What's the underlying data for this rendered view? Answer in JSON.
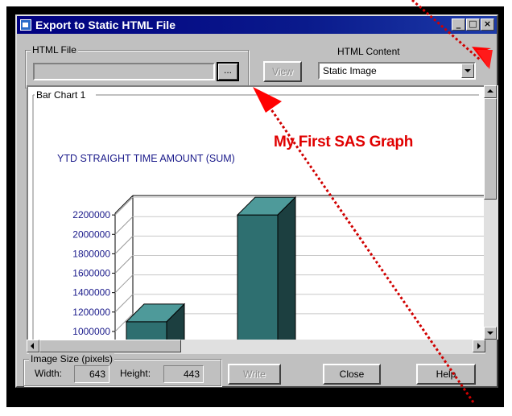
{
  "window": {
    "title": "Export to Static HTML File",
    "caption_buttons": [
      "_",
      "□",
      "×"
    ]
  },
  "html_file": {
    "group_label": "HTML File",
    "path_value": "",
    "browse_label": "...",
    "view_label": "View"
  },
  "html_content": {
    "label": "HTML Content",
    "selected": "Static Image"
  },
  "chart_pane": {
    "group_label": "Bar Chart 1"
  },
  "annotation": {
    "text": "My First SAS Graph",
    "color": "#e00000"
  },
  "image_size": {
    "group_label": "Image Size (pixels)",
    "width_label": "Width:",
    "width_value": "643",
    "height_label": "Height:",
    "height_value": "443"
  },
  "buttons": {
    "write": "Write",
    "close": "Close",
    "help": "Help"
  },
  "chart_data": {
    "type": "bar",
    "title": "YTD STRAIGHT TIME AMOUNT (SUM)",
    "ytick_labels": [
      "2200000",
      "2000000",
      "1800000",
      "1600000",
      "1400000",
      "1200000",
      "1000000"
    ],
    "ylim": [
      900000,
      2400000
    ],
    "categories": [
      "",
      ""
    ],
    "values": [
      1100000,
      2200000
    ],
    "bar_color": "#2e6f70",
    "bar_top_color": "#4e9a9a",
    "bar_side_color": "#1c3f40",
    "grid": true
  }
}
